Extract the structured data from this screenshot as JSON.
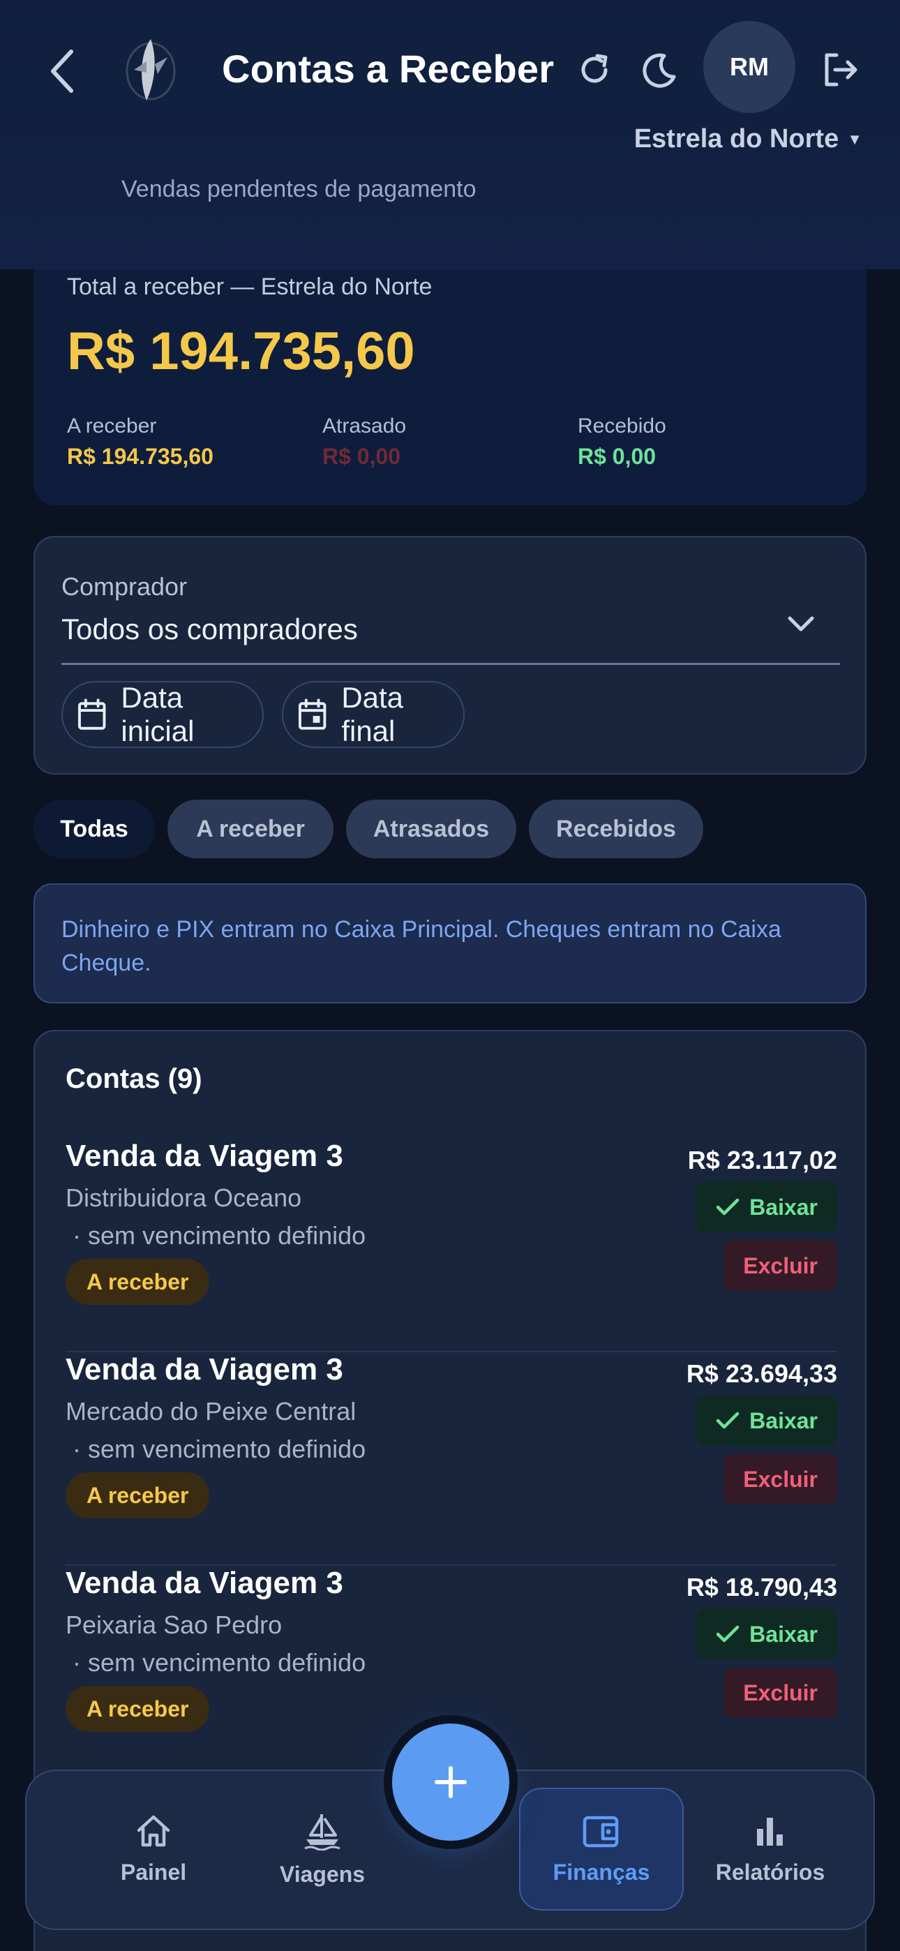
{
  "header": {
    "title": "Contas a Receber",
    "subtitle": "Vendas pendentes de pagamento",
    "avatar_initials": "RM",
    "company": "Estrela do Norte",
    "icons": [
      "back-arrow-icon",
      "logo-icon",
      "refresh-icon",
      "moon-icon",
      "logout-icon"
    ]
  },
  "summary": {
    "label": "Total a receber — Estrela do Norte",
    "total": "R$ 194.735,60",
    "cols": [
      {
        "label": "A receber",
        "value": "R$ 194.735,60",
        "color": "#f5c84a"
      },
      {
        "label": "Atrasado",
        "value": "R$ 0,00",
        "color": "#6e2a36"
      },
      {
        "label": "Recebido",
        "value": "R$ 0,00",
        "color": "#6ee39a"
      }
    ]
  },
  "filter": {
    "buyer_label": "Comprador",
    "buyer_value": "Todos os compradores",
    "date_start": "Data inicial",
    "date_end": "Data final"
  },
  "tabs": [
    {
      "label": "Todas",
      "active": true
    },
    {
      "label": "A receber",
      "active": false
    },
    {
      "label": "Atrasados",
      "active": false
    },
    {
      "label": "Recebidos",
      "active": false
    }
  ],
  "info": "Dinheiro e PIX entram no Caixa Principal. Cheques entram no Caixa Cheque.",
  "accounts": {
    "title": "Contas (9)",
    "items": [
      {
        "name": "Venda da Viagem 3",
        "buyer": "Distribuidora Oceano",
        "due": " · sem vencimento definido",
        "status": "A receber",
        "amount": "R$ 23.117,02",
        "baixar": "Baixar",
        "excluir": "Excluir"
      },
      {
        "name": "Venda da Viagem 3",
        "buyer": "Mercado do Peixe Central",
        "due": " · sem vencimento definido",
        "status": "A receber",
        "amount": "R$ 23.694,33",
        "baixar": "Baixar",
        "excluir": "Excluir"
      },
      {
        "name": "Venda da Viagem 3",
        "buyer": "Peixaria Sao Pedro",
        "due": " · sem vencimento definido",
        "status": "A receber",
        "amount": "R$ 18.790,43",
        "baixar": "Baixar",
        "excluir": "Excluir"
      }
    ]
  },
  "nav": {
    "items": [
      {
        "label": "Painel",
        "icon": "home-icon",
        "active": false
      },
      {
        "label": "Viagens",
        "icon": "sailboat-icon",
        "active": false
      },
      {
        "label": "Finanças",
        "icon": "wallet-icon",
        "active": true
      },
      {
        "label": "Relatórios",
        "icon": "bar-chart-icon",
        "active": false
      }
    ],
    "fab_icon": "plus-icon"
  },
  "colors": {
    "accent": "#5b9cf2",
    "warning": "#f5c84a",
    "success": "#6ee39a",
    "danger": "#f0607a",
    "background": "#0b1322"
  }
}
